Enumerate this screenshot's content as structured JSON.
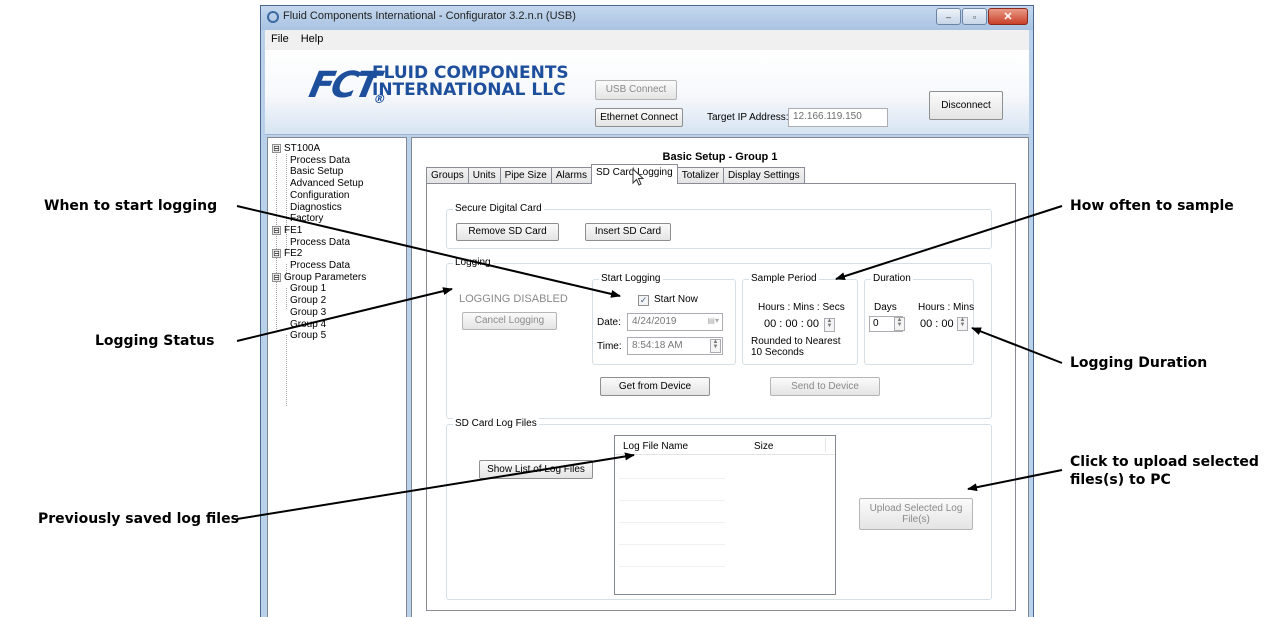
{
  "window": {
    "title": "Fluid Components International - Configurator 3.2.n.n (USB)",
    "controls": {
      "minimize": "–",
      "maximize": "▫",
      "close": "✕"
    }
  },
  "menu": [
    "File",
    "Help"
  ],
  "header": {
    "logo_mark": "FCT",
    "logo_line1": "FLUID COMPONENTS",
    "logo_line2": "INTERNATIONAL LLC",
    "usb_connect": "USB Connect",
    "ethernet_connect": "Ethernet Connect",
    "target_ip_label": "Target IP Address:",
    "target_ip_value": "12.166.119.150",
    "disconnect": "Disconnect"
  },
  "tree": [
    {
      "label": "ST100A",
      "level": 0,
      "expander": "⊟"
    },
    {
      "label": "Process Data",
      "level": 1
    },
    {
      "label": "Basic Setup",
      "level": 1
    },
    {
      "label": "Advanced Setup",
      "level": 1
    },
    {
      "label": "Configuration",
      "level": 1
    },
    {
      "label": "Diagnostics",
      "level": 1
    },
    {
      "label": "Factory",
      "level": 1
    },
    {
      "label": "FE1",
      "level": 0,
      "expander": "⊟"
    },
    {
      "label": "Process Data",
      "level": 1
    },
    {
      "label": "FE2",
      "level": 0,
      "expander": "⊟"
    },
    {
      "label": "Process Data",
      "level": 1
    },
    {
      "label": "Group Parameters",
      "level": 0,
      "expander": "⊟"
    },
    {
      "label": "Group 1",
      "level": 1
    },
    {
      "label": "Group 2",
      "level": 1
    },
    {
      "label": "Group 3",
      "level": 1
    },
    {
      "label": "Group 4",
      "level": 1
    },
    {
      "label": "Group 5",
      "level": 1
    }
  ],
  "main": {
    "title": "Basic Setup - Group 1",
    "tabs": [
      "Groups",
      "Units",
      "Pipe Size",
      "Alarms",
      "SD Card Logging",
      "Totalizer",
      "Display Settings"
    ],
    "active_tab": "SD Card Logging",
    "sd_card": {
      "legend": "Secure Digital Card",
      "remove": "Remove SD Card",
      "insert": "Insert SD Card"
    },
    "logging": {
      "legend": "Logging",
      "status": "LOGGING DISABLED",
      "cancel": "Cancel Logging",
      "start_legend": "Start Logging",
      "start_now_label": "Start Now",
      "start_now_checked": "✓",
      "date_label": "Date:",
      "date_value": "4/24/2019",
      "time_label": "Time:",
      "time_value": "8:54:18 AM",
      "sample_legend": "Sample Period",
      "sample_units": "Hours : Mins : Secs",
      "sample_value": "00 : 00 : 00",
      "sample_note": "Rounded to Nearest 10 Seconds",
      "duration_legend": "Duration",
      "days_label": "Days",
      "hours_mins_label": "Hours : Mins",
      "days_value": "0",
      "hm_value": "00 : 00",
      "get_from_device": "Get from Device",
      "send_to_device": "Send to Device"
    },
    "log_files": {
      "legend": "SD Card Log Files",
      "show_list": "Show List of Log Files",
      "col_name": "Log File Name",
      "col_size": "Size",
      "upload": "Upload Selected Log File(s)"
    }
  },
  "callouts": {
    "start_logging": "When to start logging",
    "status": "Logging Status",
    "previous_files": "Previously saved log files",
    "sample": "How often to sample",
    "duration": "Logging Duration",
    "upload_line1": "Click to upload selected",
    "upload_line2": "files(s) to PC"
  }
}
